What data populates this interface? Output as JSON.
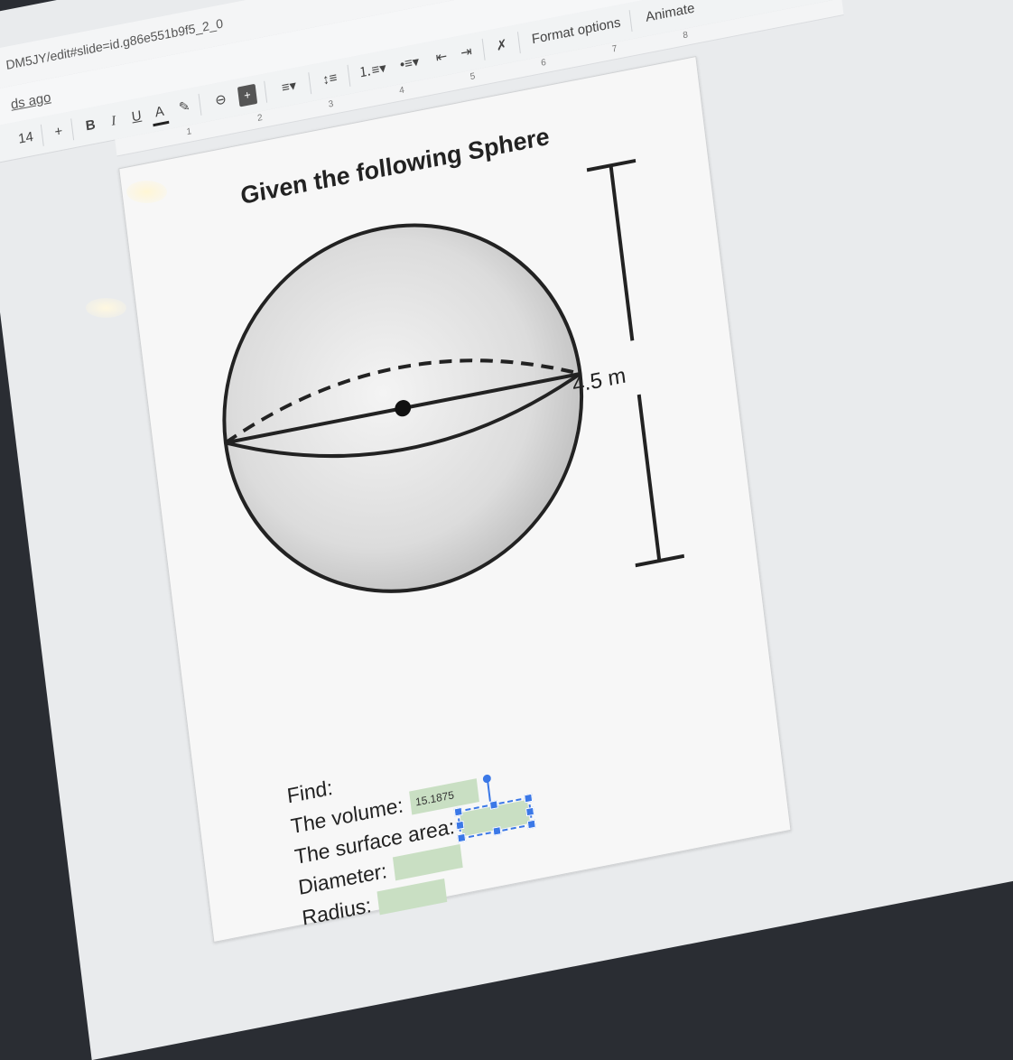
{
  "browser": {
    "url": "DM5JY/edit#slide=id.g86e551b9f5_2_0"
  },
  "menubar": {
    "saved_status": "ds ago",
    "format_options": "Format options",
    "animate": "Animate"
  },
  "toolbar": {
    "font_size": "14",
    "increase_size": "+",
    "bold": "B",
    "italic": "I",
    "underline": "U",
    "text_color": "A"
  },
  "ruler": {
    "ticks": [
      "1",
      "2",
      "3",
      "4",
      "5",
      "6",
      "7",
      "8"
    ]
  },
  "slide": {
    "title": "Given the following Sphere",
    "dimension_label": "4.5 m",
    "find_label": "Find:",
    "questions": [
      {
        "label": "The volume:",
        "answer": "15.1875"
      },
      {
        "label": "The surface area:",
        "answer": ""
      },
      {
        "label": "Diameter:",
        "answer": ""
      },
      {
        "label": "Radius:",
        "answer": ""
      }
    ]
  },
  "colors": {
    "answer_box": "#c9dfc3",
    "selection": "#3b78e7"
  }
}
